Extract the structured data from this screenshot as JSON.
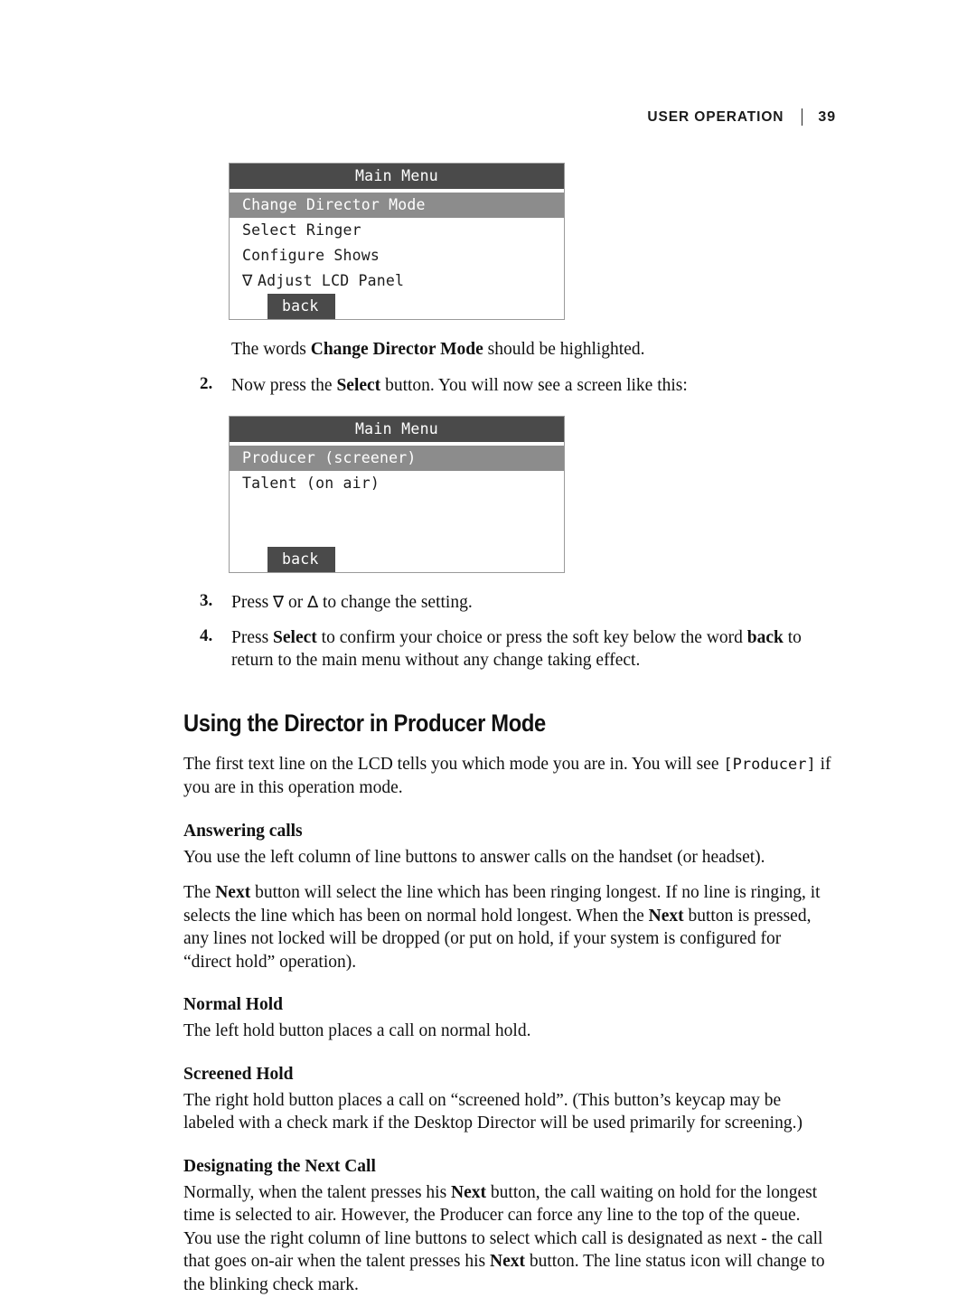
{
  "header": {
    "section_label": "USER OPERATION",
    "page_number": "39"
  },
  "lcd_screens": [
    {
      "title": "Main Menu",
      "rows": [
        {
          "marker": "",
          "text": "Change Director Mode",
          "selected": true
        },
        {
          "marker": "",
          "text": "Select Ringer",
          "selected": false
        },
        {
          "marker": "",
          "text": "Configure Shows",
          "selected": false
        },
        {
          "marker": "∇",
          "text": "Adjust LCD Panel",
          "selected": false
        }
      ],
      "softkey": "back"
    },
    {
      "title": "Main Menu",
      "rows": [
        {
          "marker": "",
          "text": "Producer (screener)",
          "selected": true
        },
        {
          "marker": "",
          "text": "Talent (on air)",
          "selected": false
        }
      ],
      "softkey": "back"
    }
  ],
  "caption_after_first_screen": {
    "lead": "The words ",
    "bold": "Change Director Mode",
    "tail": " should be highlighted."
  },
  "steps": [
    {
      "number": "2.",
      "parts": [
        {
          "t": "Now press the ",
          "b": false
        },
        {
          "t": "Select",
          "b": true
        },
        {
          "t": " button. You will now see a screen like this:",
          "b": false
        }
      ]
    },
    {
      "number": "3.",
      "parts": [
        {
          "t": "Press ",
          "b": false
        },
        {
          "t": "∇",
          "b": false,
          "glyph": true
        },
        {
          "t": " or ",
          "b": false
        },
        {
          "t": "∆",
          "b": false,
          "glyph": true
        },
        {
          "t": " to change the setting.",
          "b": false
        }
      ]
    },
    {
      "number": "4.",
      "parts": [
        {
          "t": "Press ",
          "b": false
        },
        {
          "t": "Select",
          "b": true
        },
        {
          "t": " to confirm your choice or press the soft key below the word ",
          "b": false
        },
        {
          "t": "back",
          "b": true
        },
        {
          "t": " to return to the main menu without any change taking effect.",
          "b": false
        }
      ]
    }
  ],
  "section": {
    "heading": "Using the Director in Producer Mode",
    "intro": {
      "part1": "The first text line on the LCD tells you which mode you are in. You will see ",
      "code": "[Producer]",
      "part2": " if you are in this operation mode."
    },
    "subsections": [
      {
        "title": "Answering calls",
        "paragraphs": [
          {
            "parts": [
              {
                "t": "You use the left column of line buttons to answer calls on the handset (or headset).",
                "b": false
              }
            ]
          },
          {
            "parts": [
              {
                "t": "The ",
                "b": false
              },
              {
                "t": "Next",
                "b": true
              },
              {
                "t": " button will select the line which has been ringing longest. If no line is ringing, it selects the line which has been on normal hold longest. When the ",
                "b": false
              },
              {
                "t": "Next",
                "b": true
              },
              {
                "t": " button is pressed, any lines not locked will be dropped (or put on hold, if your system is configured for “direct hold” operation).",
                "b": false
              }
            ]
          }
        ]
      },
      {
        "title": "Normal Hold",
        "paragraphs": [
          {
            "parts": [
              {
                "t": "The left hold button places a call on normal hold.",
                "b": false
              }
            ]
          }
        ]
      },
      {
        "title": "Screened Hold",
        "paragraphs": [
          {
            "parts": [
              {
                "t": "The right hold button places a call on “screened hold”. (This button’s keycap may be labeled with a check mark if the Desktop Director will be used primarily for screening.)",
                "b": false
              }
            ]
          }
        ]
      },
      {
        "title": "Designating the Next Call",
        "paragraphs": [
          {
            "parts": [
              {
                "t": "Normally, when the talent presses his ",
                "b": false
              },
              {
                "t": "Next",
                "b": true
              },
              {
                "t": " button, the call waiting on hold for the longest time is selected to air. However, the Producer can force any line to the top of the queue. You use the right column of line buttons to select which call is designated as next - the call that goes on-air when the talent presses his ",
                "b": false
              },
              {
                "t": "Next",
                "b": true
              },
              {
                "t": " button. The line status icon will change to the blinking check mark.",
                "b": false
              }
            ]
          }
        ]
      }
    ]
  }
}
